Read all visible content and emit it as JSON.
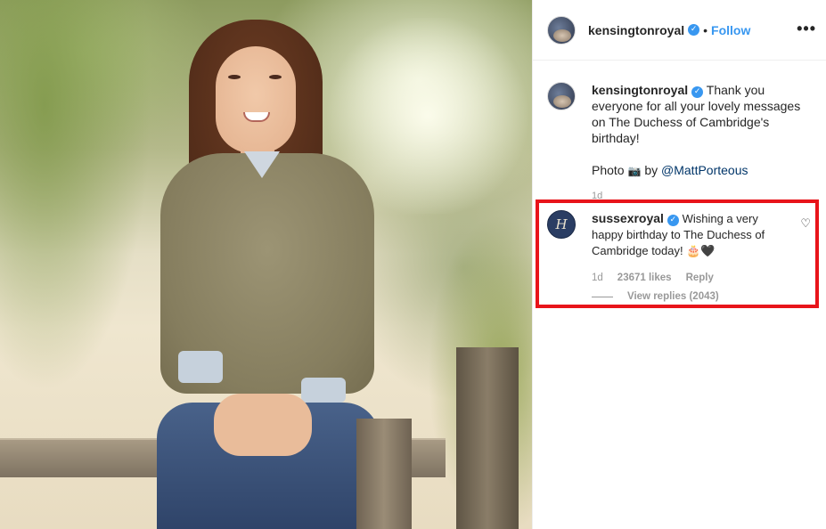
{
  "post": {
    "username": "kensingtonroyal",
    "follow_label": "Follow",
    "separator": "•",
    "more_label": "•••"
  },
  "caption": {
    "username": "kensingtonroyal",
    "text": "Thank you everyone for all your lovely messages on The Duchess of Cambridge's birthday!",
    "credit_prefix": "Photo",
    "credit_icon": "📷",
    "credit_by": "by",
    "credit_mention": "@MattPorteous",
    "age": "1d"
  },
  "comment": {
    "username": "sussexroyal",
    "avatar_letter": "H",
    "text": "Wishing a very happy birthday to The Duchess of Cambridge today! 🎂🖤",
    "age": "1d",
    "likes": "23671 likes",
    "reply_label": "Reply",
    "view_replies": "View replies (2043)",
    "heart_icon": "♡"
  },
  "colors": {
    "accent_blue": "#3897f0",
    "highlight_red": "#e8141a",
    "secondary_text": "#999999"
  }
}
